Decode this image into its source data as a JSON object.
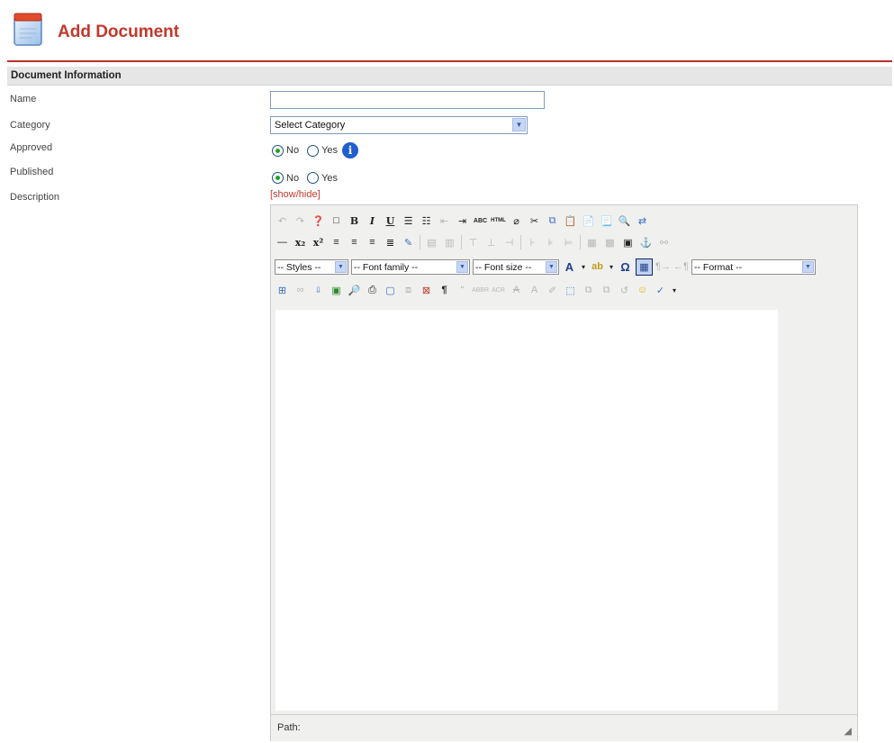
{
  "header": {
    "title": "Add Document",
    "icon": "document-calendar-icon"
  },
  "section": {
    "title": "Document Information"
  },
  "form": {
    "name": {
      "label": "Name",
      "value": ""
    },
    "category": {
      "label": "Category",
      "selected": "Select Category"
    },
    "approved": {
      "label": "Approved",
      "options": [
        "No",
        "Yes"
      ],
      "selected": "No"
    },
    "published": {
      "label": "Published",
      "options": [
        "No",
        "Yes"
      ],
      "selected": "No"
    },
    "description": {
      "label": "Description",
      "toggle": "[show/hide]"
    }
  },
  "editor": {
    "styles": "-- Styles --",
    "font_family": "-- Font family --",
    "font_size": "-- Font size --",
    "format": "-- Format --",
    "path_label": "Path:"
  },
  "colors": {
    "brand": "#c0392b",
    "rule": "#b8322a",
    "section_bg": "#e6e6e6",
    "editor_bg": "#f0f0ee"
  }
}
